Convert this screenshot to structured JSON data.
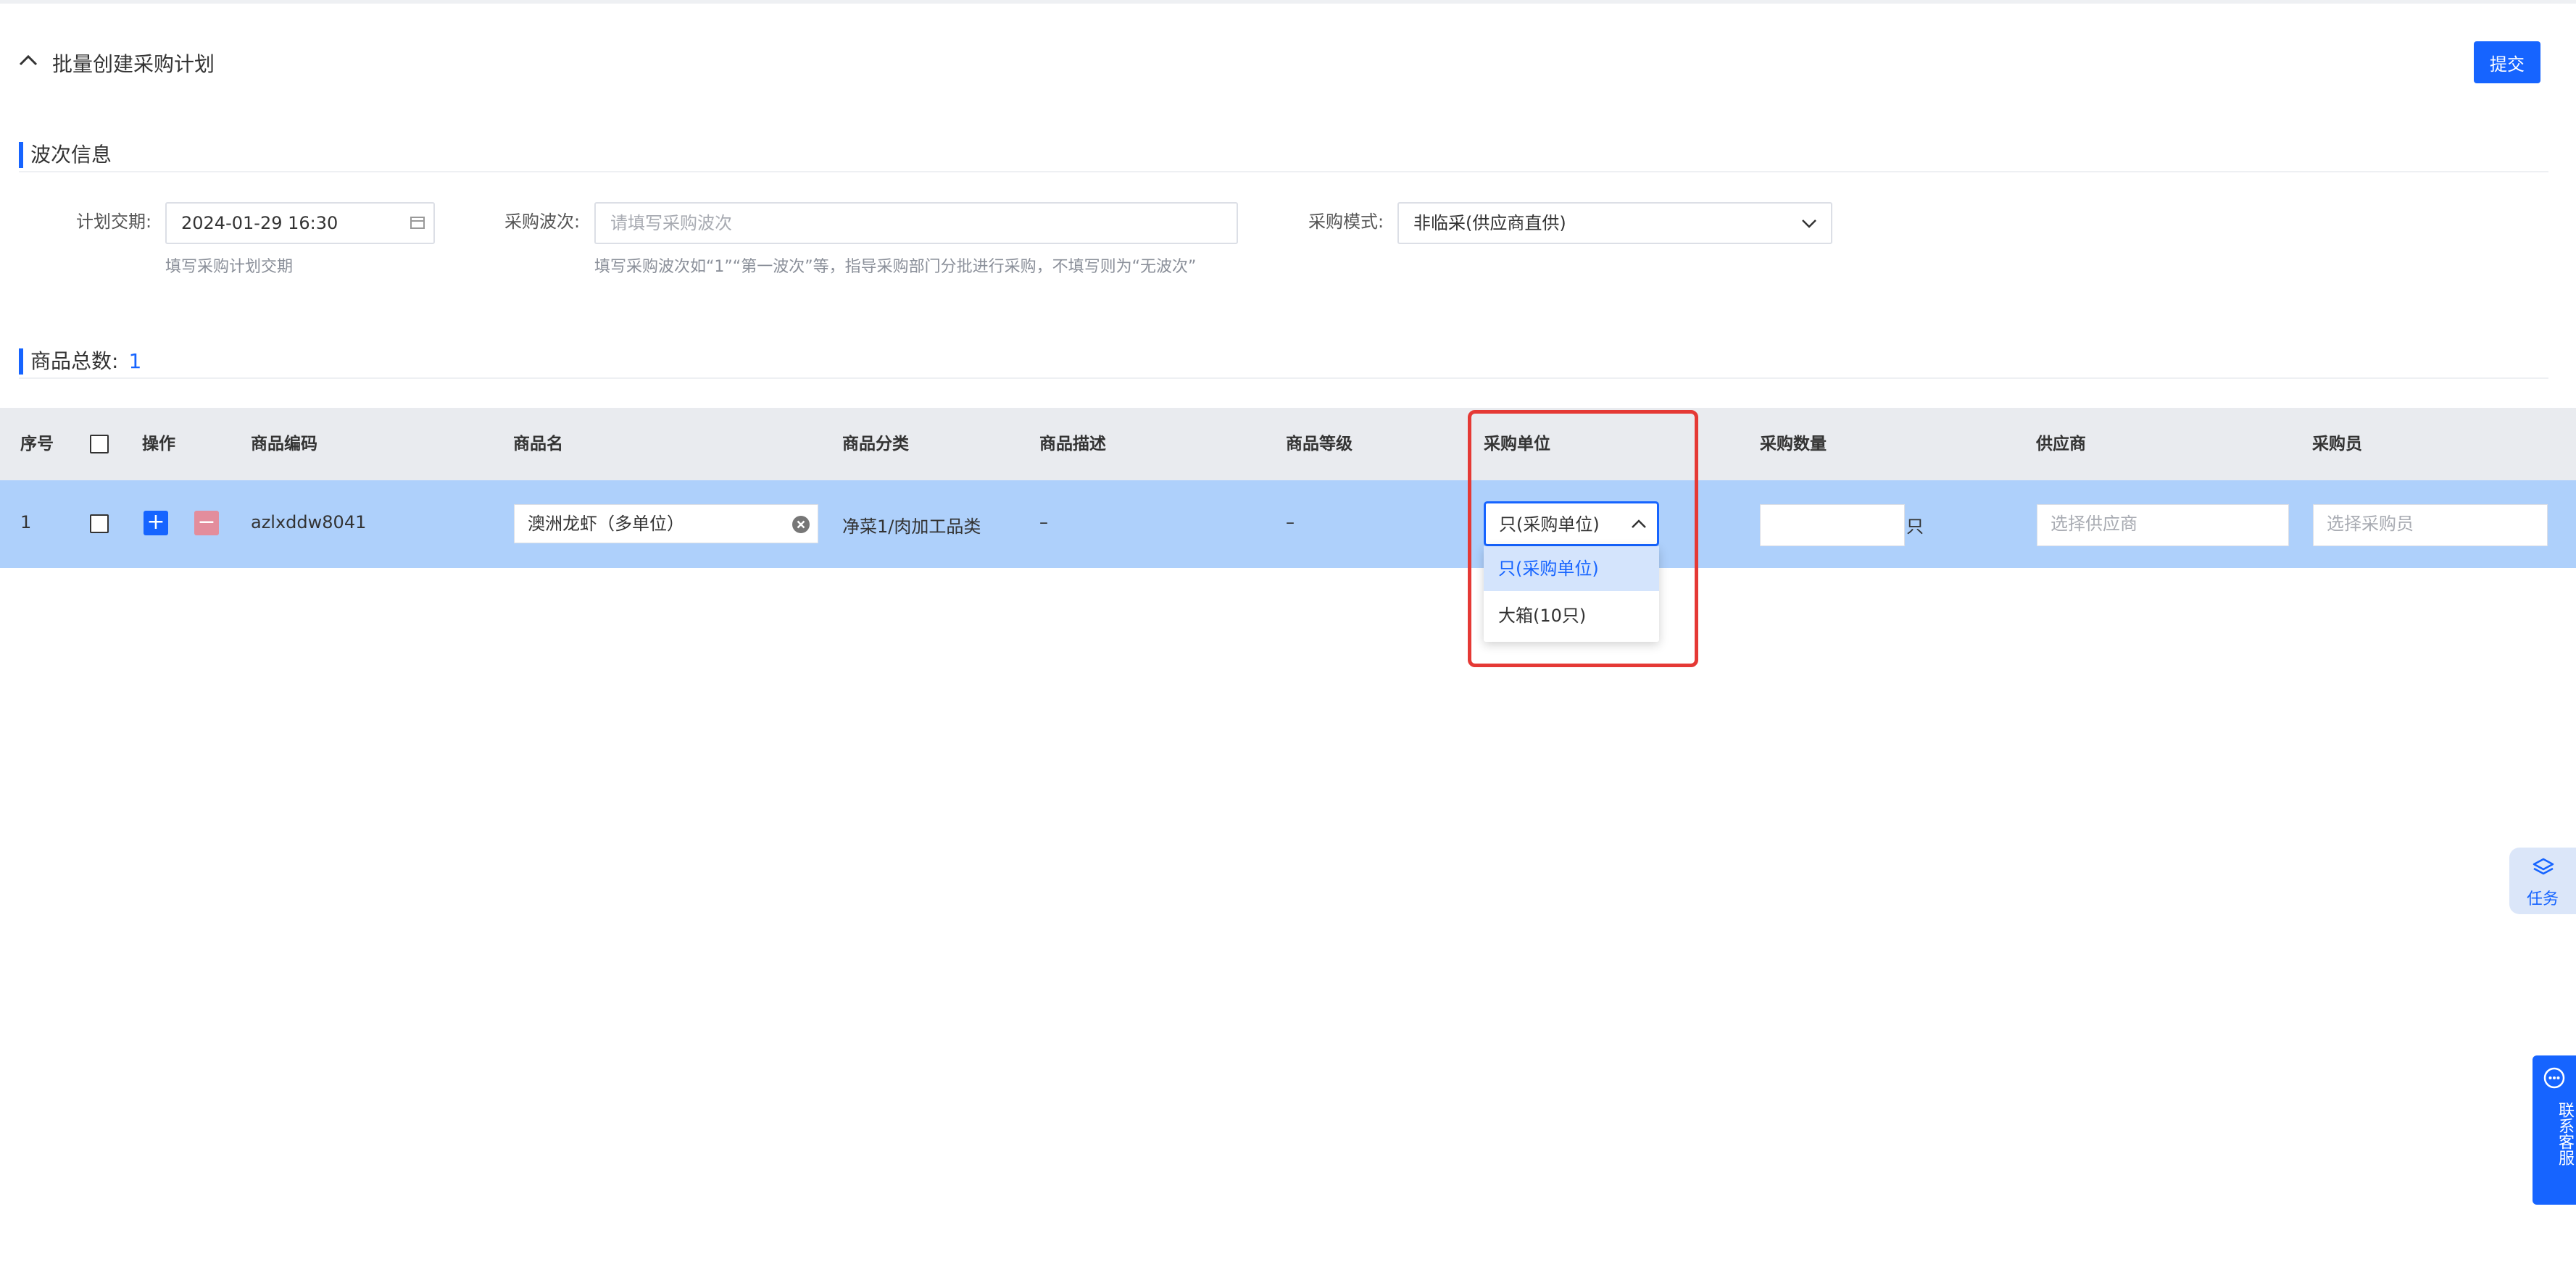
{
  "header": {
    "title": "批量创建采购计划",
    "submit_label": "提交"
  },
  "wave_section": {
    "title": "波次信息",
    "plan_date": {
      "label": "计划交期:",
      "value": "2024-01-29 16:30",
      "hint": "填写采购计划交期"
    },
    "wave": {
      "label": "采购波次:",
      "placeholder": "请填写采购波次",
      "hint": "填写采购波次如“1”“第一波次”等，指导采购部门分批进行采购，不填写则为“无波次”"
    },
    "mode": {
      "label": "采购模式:",
      "value": "非临采(供应商直供)"
    }
  },
  "goods_section": {
    "title_label": "商品总数:",
    "count": "1"
  },
  "table": {
    "columns": [
      "序号",
      "操作",
      "商品编码",
      "商品名",
      "商品分类",
      "商品描述",
      "商品等级",
      "采购单位",
      "采购数量",
      "供应商",
      "采购员"
    ],
    "rows": [
      {
        "index": "1",
        "add_label": "+",
        "remove_label": "−",
        "code": "azlxddw8041",
        "name": "澳洲龙虾（多单位）",
        "category": "净菜1/肉加工品类",
        "description": "–",
        "grade": "–",
        "unit": "只(采购单位)",
        "quantity": "",
        "quantity_unit": "只",
        "supplier_placeholder": "选择供应商",
        "buyer_placeholder": "选择采购员"
      }
    ]
  },
  "unit_dropdown": {
    "options": [
      "只(采购单位)",
      "大箱(10只)"
    ],
    "selected": "只(采购单位)"
  },
  "widgets": {
    "task_label": "任务",
    "service_label": "联系客服"
  },
  "colors": {
    "accent": "#1664ff",
    "row_highlight": "#aed0fb",
    "annotation": "#e53935"
  }
}
